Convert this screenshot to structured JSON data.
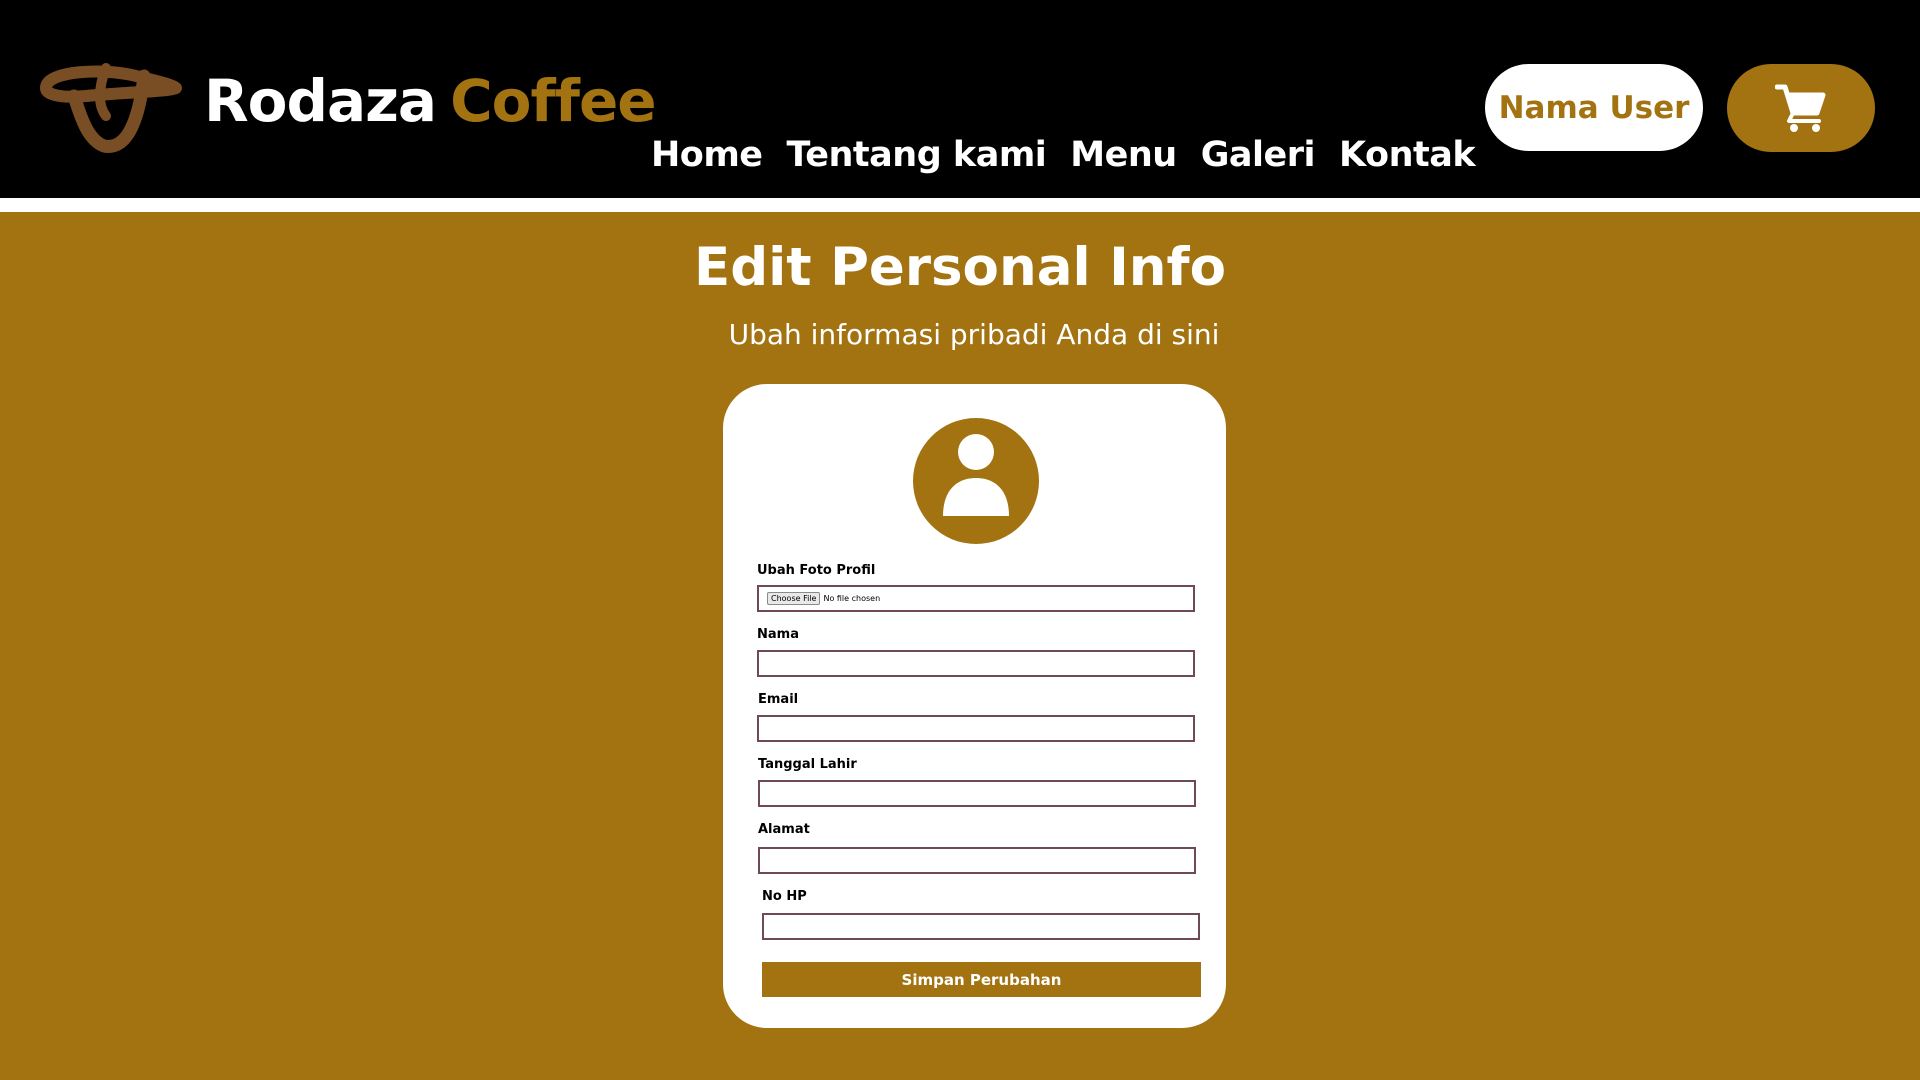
{
  "brand": {
    "name_part1": "Rodaza",
    "name_part2": "Coffee",
    "logo_icon": "coffee-bean-logo-icon",
    "logo_color": "#7a4e24"
  },
  "nav": {
    "items": [
      {
        "label": "Home"
      },
      {
        "label": "Tentang kami"
      },
      {
        "label": "Menu"
      },
      {
        "label": "Galeri"
      },
      {
        "label": "Kontak"
      }
    ]
  },
  "header_actions": {
    "user_label": "Nama User",
    "cart_icon": "cart-icon"
  },
  "page": {
    "title": "Edit Personal Info",
    "subtitle": "Ubah informasi pribadi Anda di sini"
  },
  "form": {
    "avatar_icon": "user-avatar-icon",
    "photo": {
      "label": "Ubah Foto Profil",
      "button_label": "Choose File",
      "status_text": "No file chosen"
    },
    "fields": [
      {
        "label": "Nama",
        "value": ""
      },
      {
        "label": "Email",
        "value": ""
      },
      {
        "label": "Tanggal Lahir",
        "value": ""
      },
      {
        "label": "Alamat",
        "value": ""
      },
      {
        "label": "No HP",
        "value": ""
      }
    ],
    "submit_label": "Simpan Perubahan"
  },
  "colors": {
    "accent": "#a27310",
    "header_bg": "#000000",
    "input_border": "#6e4a55",
    "card_bg": "#ffffff"
  }
}
